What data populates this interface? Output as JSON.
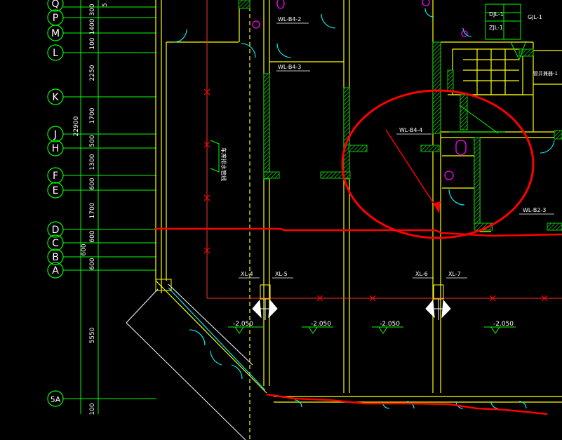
{
  "grid_axes": [
    "Q",
    "P",
    "M",
    "L",
    "K",
    "J",
    "H",
    "F",
    "E",
    "D",
    "C",
    "B",
    "A",
    "5A"
  ],
  "dims_inner": [
    "300",
    "1400",
    "100",
    "2250",
    "1700",
    "500",
    "1300",
    "600",
    "1700",
    "600",
    "600",
    "5550",
    "100"
  ],
  "dims_outer": [
    "22900",
    "600"
  ],
  "dim_top_extra": "5",
  "tags": {
    "wl_b4_2": "WL-B4-2",
    "wl_b4_3": "WL-B4-3",
    "wl_b4_4": "WL-B4-4",
    "wl_b2_3": "WL-B2-3",
    "djl_1": "DJL-1",
    "zjl_1": "ZJL-1",
    "gjl_1": "GJL-1",
    "xl_4": "XL-4",
    "xl_5": "XL-5",
    "xl_6": "XL-6",
    "xl_7": "XL-7",
    "stair_note": "管井兼器-1",
    "vertical_note": "车库排水管线"
  },
  "elevations": [
    "-2.050",
    "-2.050",
    "-2.050",
    "-2.050"
  ],
  "colors": {
    "background": "#000000",
    "wall": "#FFFF00",
    "grid": "#00FF00",
    "hatch": "#00C800",
    "door": "#00FFFF",
    "fixture": "#FF00FF",
    "markup": "#FF0000",
    "text": "#FFFFFF"
  }
}
